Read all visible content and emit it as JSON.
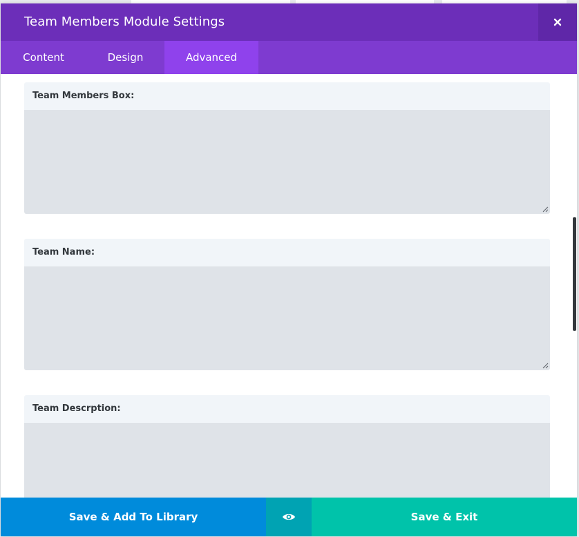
{
  "modal": {
    "title": "Team Members Module Settings",
    "close_label": "×"
  },
  "tabs": [
    {
      "label": "Content",
      "active": false
    },
    {
      "label": "Design",
      "active": false
    },
    {
      "label": "Advanced",
      "active": true
    }
  ],
  "fields": [
    {
      "label": "Team Members Box:",
      "value": ""
    },
    {
      "label": "Team Name:",
      "value": ""
    },
    {
      "label": "Team Descrption:",
      "value": ""
    }
  ],
  "footer": {
    "save_library_label": "Save & Add To Library",
    "preview_icon": "eye-icon",
    "save_exit_label": "Save & Exit"
  },
  "colors": {
    "header": "#6c2eb9",
    "tabs": "#7e3bd0",
    "active_tab": "#8f42ec",
    "library_button": "#008bdb",
    "preview_button": "#00a3b3",
    "exit_button": "#00c3aa"
  }
}
